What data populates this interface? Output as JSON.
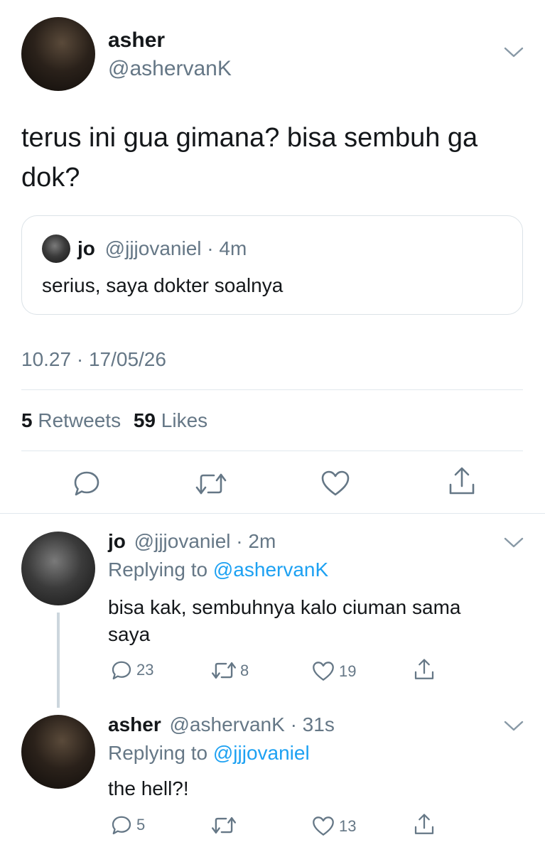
{
  "main_tweet": {
    "display_name": "asher",
    "handle": "@ashervanK",
    "text_line1": "terus ini gua gimana? bisa sembuh ga",
    "text_line2": "dok?",
    "timestamp": "10.27 · 17/05/26",
    "retweets_count": "5",
    "retweets_label": "Retweets",
    "likes_count": "59",
    "likes_label": "Likes"
  },
  "quoted_tweet": {
    "display_name": "jo",
    "handle_time": "@jjjovaniel · 4m",
    "text": "serius, saya dokter soalnya"
  },
  "replies": [
    {
      "display_name": "jo",
      "handle_time": "@jjjovaniel · 2m",
      "replying_prefix": "Replying to",
      "replying_to": "@ashervanK",
      "text_line1": "bisa kak, sembuhnya kalo ciuman sama",
      "text_line2": "saya",
      "reply_count": "23",
      "retweet_count": "8",
      "like_count": "19"
    },
    {
      "display_name": "asher",
      "handle_time": "@ashervanK · 31s",
      "replying_prefix": "Replying to",
      "replying_to": "@jjjovaniel",
      "text_line1": "the hell?!",
      "reply_count": "5",
      "retweet_count": "",
      "like_count": "13"
    }
  ],
  "icons": {
    "reply": "reply-icon",
    "retweet": "retweet-icon",
    "like": "heart-icon",
    "share": "share-icon",
    "more": "chevron-down-icon"
  },
  "colors": {
    "text": "#14171a",
    "secondary": "#657786",
    "link": "#1da1f2",
    "divider": "#e1e8ed"
  }
}
